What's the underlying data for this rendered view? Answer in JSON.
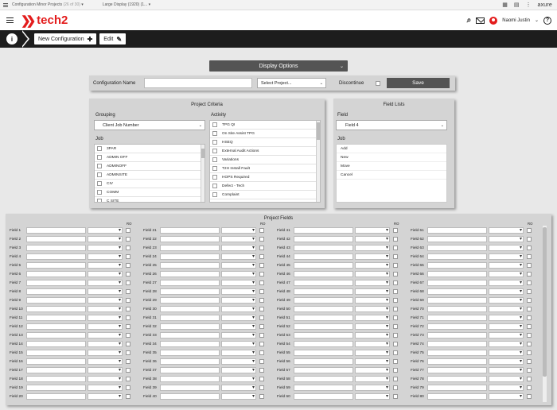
{
  "chrome": {
    "title": "Configuration Minor Projects",
    "title_count": "(26 of 30)",
    "display": "Large Display (1920) (1...",
    "axure": "axure"
  },
  "header": {
    "logo_text": "tech2",
    "user_name": "Naomi Justin"
  },
  "toolbar": {
    "new_label": "New Configuration",
    "edit_label": "Edit"
  },
  "display_options": "Display Options",
  "config": {
    "name_label": "Configuration Name",
    "name_value": "",
    "project_select": "Select Project...",
    "discontinue_label": "Discontinue",
    "save_label": "Save"
  },
  "criteria": {
    "title": "Project Criteria",
    "grouping_label": "Grouping",
    "grouping_value": "Client Job Number",
    "job_label": "Job",
    "jobs": [
      "3PAR",
      "ADMIN OFF",
      "ADMINOFF",
      "ADMINSITE",
      "CIV",
      "COMM",
      "C SITE"
    ],
    "activity_label": "Activity",
    "activities": [
      "TPG QI",
      "On Site Assist TPG",
      "HSEQ",
      "External Audit Actions",
      "Variations",
      "T2H Install Fault",
      "HOPS Required",
      "Defect - Tech",
      "Complaint"
    ]
  },
  "field_lists": {
    "title": "Field Lists",
    "field_label": "Field",
    "field_value": "Field 4",
    "job_label": "Job",
    "items": [
      "Add",
      "New",
      "Move",
      "Cancel"
    ]
  },
  "project_fields": {
    "title": "Project Fields",
    "ro_label": "RO",
    "columns": [
      [
        "Field 1",
        "Field 2",
        "Field 3",
        "Field 4",
        "Field 5",
        "Field 6",
        "Field 7",
        "Field 8",
        "Field 9",
        "Field 10",
        "Field 11",
        "Field 12",
        "Field 13",
        "Field 14",
        "Field 15",
        "Field 16",
        "Field 17",
        "Field 18",
        "Field 19",
        "Field 20"
      ],
      [
        "Field 21",
        "Field 22",
        "Field 23",
        "Field 24",
        "Field 25",
        "Field 26",
        "Field 27",
        "Field 28",
        "Field 29",
        "Field 30",
        "Field 31",
        "Field 32",
        "Field 33",
        "Field 34",
        "Field 35",
        "Field 36",
        "Field 37",
        "Field 38",
        "Field 39",
        "Field 40"
      ],
      [
        "Field 41",
        "Field 42",
        "Field 43",
        "Field 44",
        "Field 45",
        "Field 46",
        "Field 47",
        "Field 48",
        "Field 49",
        "Field 50",
        "Field 51",
        "Field 52",
        "Field 53",
        "Field 54",
        "Field 55",
        "Field 56",
        "Field 57",
        "Field 58",
        "Field 59",
        "Field 60"
      ],
      [
        "Field 61",
        "Field 62",
        "Field 63",
        "Field 64",
        "Field 65",
        "Field 66",
        "Field 67",
        "Field 68",
        "Field 69",
        "Field 70",
        "Field 71",
        "Field 72",
        "Field 73",
        "Field 74",
        "Field 75",
        "Field 76",
        "Field 77",
        "Field 78",
        "Field 79",
        "Field 80"
      ]
    ]
  }
}
